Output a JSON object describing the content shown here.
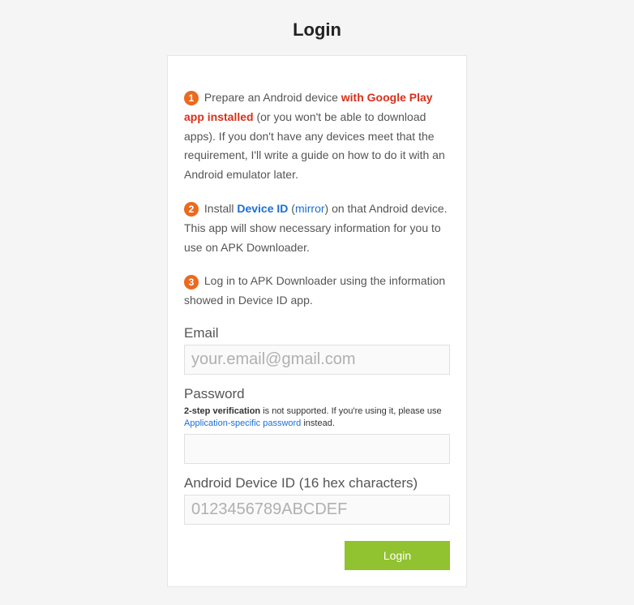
{
  "title": "Login",
  "steps": {
    "s1": {
      "num": "1",
      "pre": " Prepare an Android device ",
      "highlight": "with Google Play app installed",
      "post": " (or you won't be able to download apps). If you don't have any devices meet that the requirement, I'll write a guide on how to do it with an Android emulator later."
    },
    "s2": {
      "num": "2",
      "pre": " Install ",
      "link1": "Device ID",
      "paren_open": " (",
      "link2": "mirror",
      "paren_close": ")",
      "post": " on that Android device. This app will show necessary information for you to use on APK Downloader."
    },
    "s3": {
      "num": "3",
      "text": " Log in to APK Downloader using the information showed in Device ID app."
    }
  },
  "fields": {
    "email": {
      "label": "Email",
      "placeholder": "your.email@gmail.com"
    },
    "password": {
      "label": "Password",
      "note_bold": "2-step verification",
      "note_mid": " is not supported. If you're using it, please use ",
      "note_link": "Application-specific password",
      "note_end": " instead."
    },
    "device": {
      "label": "Android Device ID (16 hex characters)",
      "placeholder": "0123456789ABCDEF"
    }
  },
  "buttons": {
    "login": "Login"
  }
}
